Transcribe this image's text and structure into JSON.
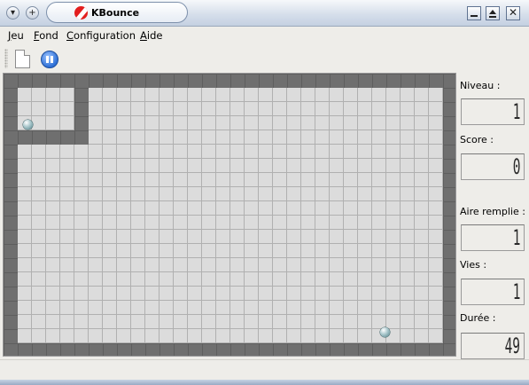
{
  "window": {
    "title": "KBounce",
    "titlebar_left_buttons": [
      "menu-button",
      "sticky-button"
    ],
    "titlebar_right_buttons": [
      "minimize-button",
      "maximize-button",
      "close-button"
    ]
  },
  "menubar": {
    "items": [
      {
        "label_underlined": "J",
        "label_rest": "eu"
      },
      {
        "label_underlined": "F",
        "label_rest": "ond"
      },
      {
        "label_underlined": "C",
        "label_rest": "onfiguration"
      },
      {
        "label_underlined": "A",
        "label_rest": "ide"
      }
    ]
  },
  "toolbar": {
    "items": [
      "new-game-icon",
      "pause-icon"
    ]
  },
  "board": {
    "columns": 32,
    "rows": 20,
    "colors": {
      "empty": "#dcdcdc",
      "wall": "#6f6f6f",
      "grid": "#b0b0b0"
    }
  },
  "panel": {
    "level_label": "Niveau :",
    "level_value": "1",
    "score_label": "Score :",
    "score_value": "0",
    "filled_label": "Aire remplie :",
    "filled_value": "1",
    "lives_label": "Vies :",
    "lives_value": "1",
    "time_label": "Durée :",
    "time_value": "49"
  }
}
